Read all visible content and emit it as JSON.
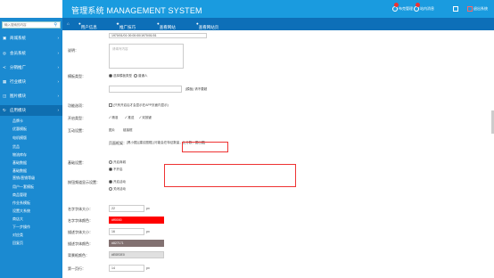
{
  "app": {
    "title": "管理系统 MANAGEMENT SYSTEM"
  },
  "topbar": {
    "items": [
      {
        "icon": "user-icon",
        "label": "布克管理"
      },
      {
        "icon": "message-icon",
        "label": "站内消息"
      },
      {
        "icon": "grid-icon",
        "label": ""
      },
      {
        "icon": "logout-icon",
        "label": "退出系统"
      }
    ]
  },
  "nav": {
    "items": [
      {
        "icon": "home-icon",
        "label": ""
      },
      {
        "icon": "user-icon",
        "label": "用户信息"
      },
      {
        "icon": "star-icon",
        "label": "推广技巧"
      },
      {
        "icon": "globe-icon",
        "label": "查看网站"
      },
      {
        "icon": "globe-icon",
        "label": "查看网站页"
      }
    ]
  },
  "sidebar": {
    "search_placeholder": "输入搜索的内容",
    "menu": [
      {
        "label": "商城系统",
        "icon": "cart-icon"
      },
      {
        "label": "会员系统",
        "icon": "user-circle-icon"
      },
      {
        "label": "分销推广",
        "icon": "share-icon"
      },
      {
        "label": "行业模块",
        "icon": "grid-icon"
      },
      {
        "label": "图片模块",
        "icon": "image-icon"
      },
      {
        "label": "应用模块",
        "icon": "refresh-icon"
      }
    ],
    "submenu": [
      "品牌卡",
      "优惠模板",
      "电机模版",
      "货品",
      "物流库存",
      "基础数据",
      "基础数据",
      "营销/营销等级",
      "用户一套模板",
      "商品管理",
      "作业系模板",
      "设置大系统",
      "商店大",
      "下一步操作",
      "对应类",
      "回复页"
    ]
  },
  "form": {
    "top_code": "1970/01/01 00:00:00/1970/01/01",
    "description_label": "说明：",
    "description_placeholder": "请填写内容",
    "mode_label": "模板类型：",
    "mode_options": [
      "选择模板类型",
      "普通人"
    ],
    "input_hint": "(模板) 请不要超",
    "feature_label": "功能选项：",
    "feature_check": "(只有开启后才会显示在APP页面内显示)",
    "switch_label": "开启类型：",
    "switch_options": [
      "精准",
      "推送",
      "双按键"
    ],
    "link_label": "互动设置：",
    "link_options": [
      "图片",
      "链接框"
    ],
    "layout_label": "页面框架：",
    "layout_text": "[黑小图]  [建议图框] [可能会在特征数量，比分数，图出图]",
    "setting_label": "基础设置：",
    "setting_options": [
      "开启商城",
      "不开启"
    ],
    "display_label": "按钮频道显示设置：",
    "display_options": [
      "开启活动",
      "关闭活动"
    ],
    "font_size_label": "名字字体大小：",
    "font_size_value": "22",
    "font_size_unit": "px",
    "name_color_label": "名字字体颜色：",
    "name_color_value": "#ff0000",
    "detail_size_label": "描述字体大小：",
    "detail_size_value": "16",
    "detail_size_unit": "px",
    "detail_color_label": "描述字体颜色：",
    "detail_color_value": "#827171",
    "bg_color_label": "背景框颜色：",
    "bg_color_value": "#E0E0E0",
    "bottom_label": "第一页行：",
    "bottom_value": "14",
    "bottom_unit": "px"
  },
  "colors": {
    "accent": "#1a9bdf",
    "nav": "#0d6fb8",
    "sidebar": "#1b8ad1",
    "red": "#ff0000",
    "brown": "#827171",
    "gray": "#e0e0e0"
  }
}
